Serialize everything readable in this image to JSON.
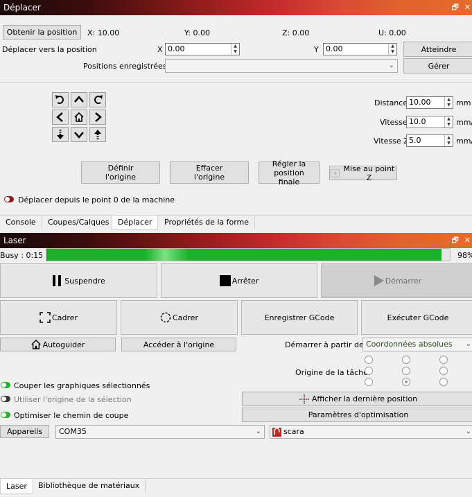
{
  "move_panel": {
    "title": "Déplacer",
    "get_position_label": "Obtenir la position",
    "x_readout": "X: 10.00",
    "y_readout": "Y: 0.00",
    "z_readout": "Z: 0.00",
    "u_readout": "U: 0.00",
    "move_to_label": "Déplacer vers la position",
    "x_label": "X",
    "x_value": "0.00",
    "y_label": "Y",
    "y_value": "0.00",
    "reach_label": "Atteindre",
    "saved_positions_label": "Positions enregistrées :",
    "saved_positions_value": "",
    "manage_label": "Gérer",
    "distance_label": "Distance",
    "distance_value": "10.00",
    "distance_unit": "mm",
    "speed_label": "Vitesse",
    "speed_value": "10.0",
    "speed_unit": "mm/s",
    "speed_z_label": "Vitesse Z",
    "speed_z_value": "5.0",
    "speed_z_unit": "mm/s",
    "set_origin_label": "Définir\nl'origine",
    "clear_origin_label": "Effacer\nl'origine",
    "set_final_label": "Régler la position\nfinale",
    "focus_z_label": "Mise au point Z",
    "move_from_zero_label": "Déplacer depuis le point 0 de la machine"
  },
  "top_tabs": [
    "Console",
    "Coupes/Calques",
    "Déplacer",
    "Propriétés de la forme"
  ],
  "laser_panel": {
    "title": "Laser",
    "busy_label": "Busy : 0:15",
    "progress_percent": 98,
    "progress_label": "98%",
    "pause_label": "Suspendre",
    "stop_label": "Arrêter",
    "start_label": "Démarrer",
    "frame_label_1": "Cadrer",
    "frame_label_2": "Cadrer",
    "save_gcode_label": "Enregistrer GCode",
    "run_gcode_label": "Exécuter GCode",
    "home_label": "Autoguider",
    "go_origin_label": "Accéder à l'origine",
    "start_from_label": "Démarrer à partir de :",
    "start_from_value": "Coordonnées absolues",
    "job_origin_label": "Origine de la tâche",
    "cut_selected_label": "Couper les graphiques sélectionnés",
    "use_selection_origin_label": "Utiliser l'origine de la sélection",
    "optimize_path_label": "Optimiser le chemin de coupe",
    "show_last_pos_label": "Afficher la dernière position",
    "optimize_settings_label": "Paramètres d'optimisation",
    "devices_label": "Appareils",
    "port_value": "COM35",
    "device_value": "scara"
  },
  "bottom_tabs": [
    "Laser",
    "Bibliothèque de matériaux"
  ],
  "colors": {
    "progress": "#1fae2a",
    "toggle_on": "#27b22b",
    "title_gradient_start": "#1a0a0a",
    "title_gradient_end": "#e66a2a"
  }
}
